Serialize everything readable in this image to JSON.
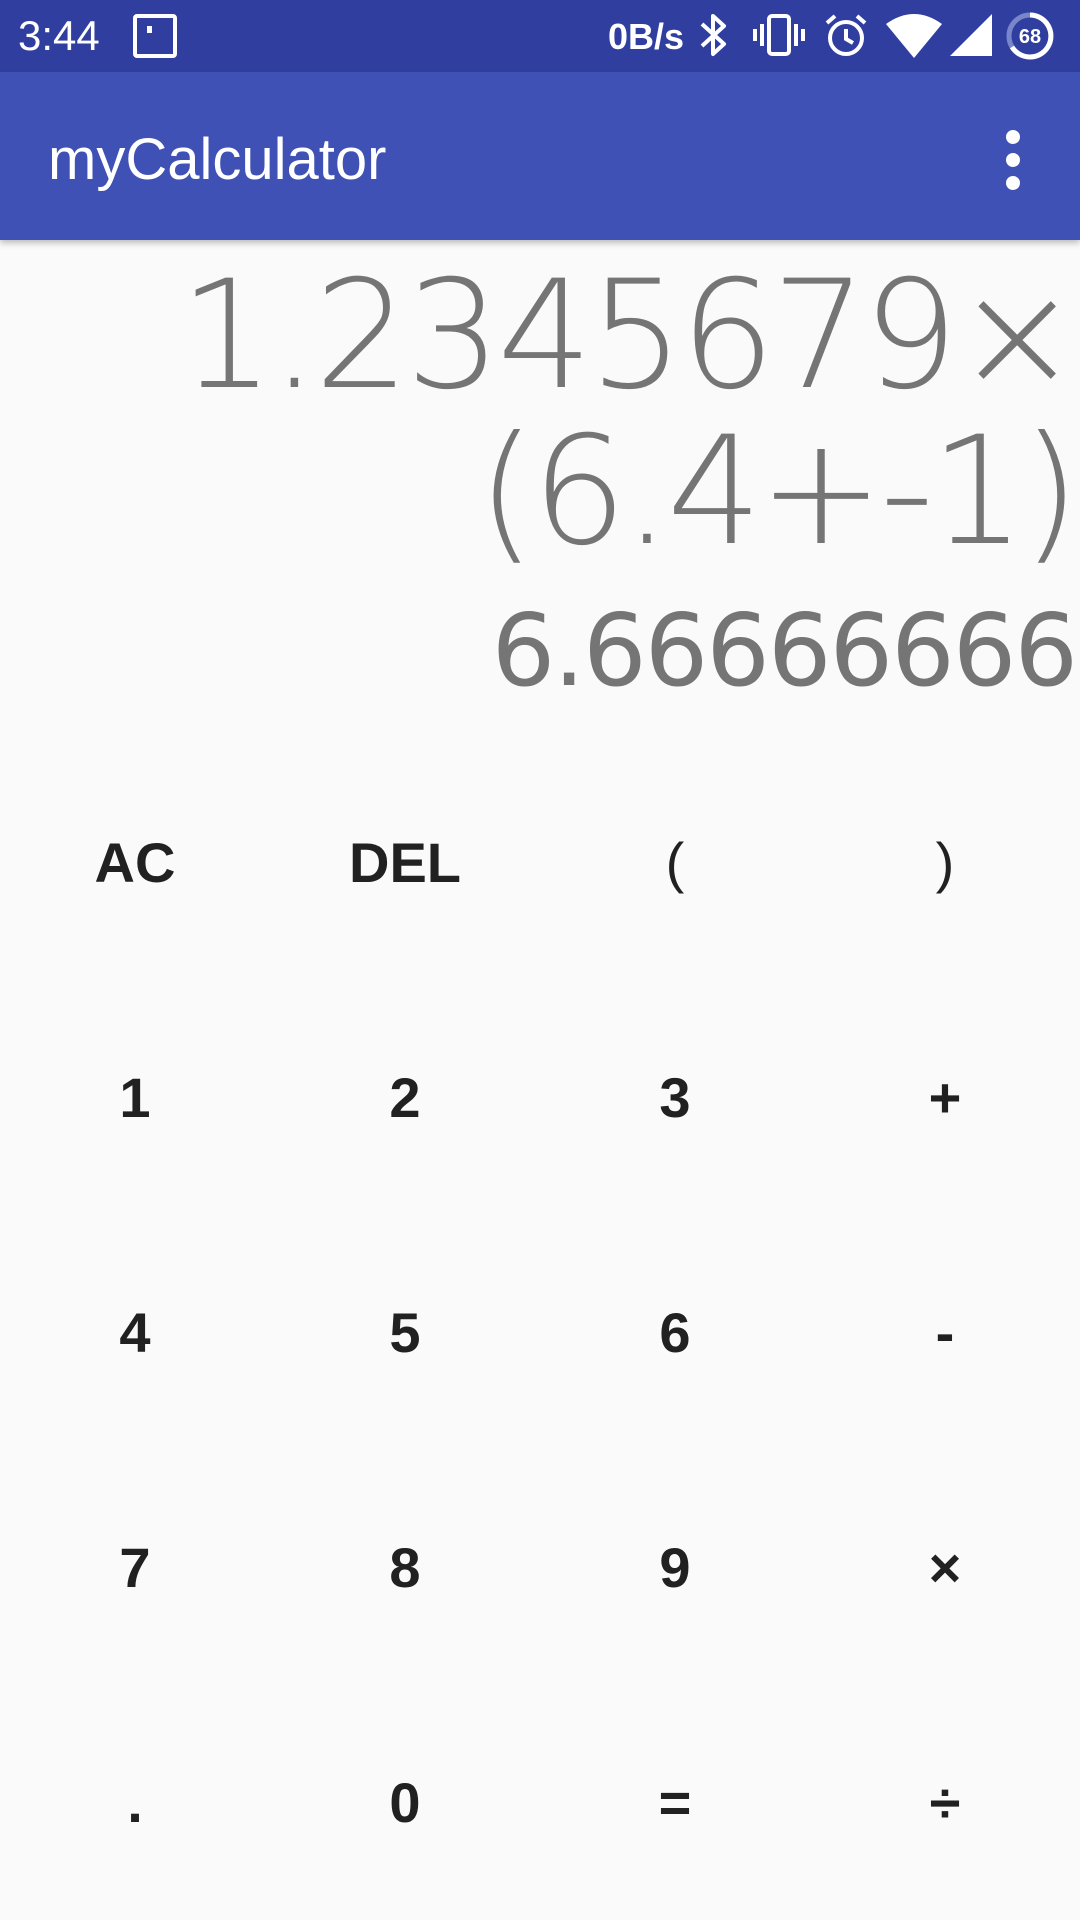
{
  "status_bar": {
    "time": "3:44",
    "network_speed": "0B/s",
    "battery_level": "68",
    "icons": [
      "notification-icon",
      "bluetooth-icon",
      "vibrate-icon",
      "alarm-icon",
      "wifi-icon",
      "signal-icon",
      "battery-icon"
    ]
  },
  "app_bar": {
    "title": "myCalculator",
    "overflow_icon": "more-vert-icon"
  },
  "display": {
    "expression": "1.2345679×(6.4+-1)",
    "result": "6.66666666"
  },
  "keypad": {
    "rows": [
      [
        "AC",
        "DEL",
        "(",
        ")"
      ],
      [
        "1",
        "2",
        "3",
        "+"
      ],
      [
        "4",
        "5",
        "6",
        "-"
      ],
      [
        "7",
        "8",
        "9",
        "×"
      ],
      [
        ".",
        "0",
        "=",
        "÷"
      ]
    ]
  },
  "colors": {
    "status_bar": "#303f9f",
    "app_bar": "#3f51b5",
    "background": "#fafafa",
    "display_text": "#757575",
    "key_text": "#212121"
  }
}
